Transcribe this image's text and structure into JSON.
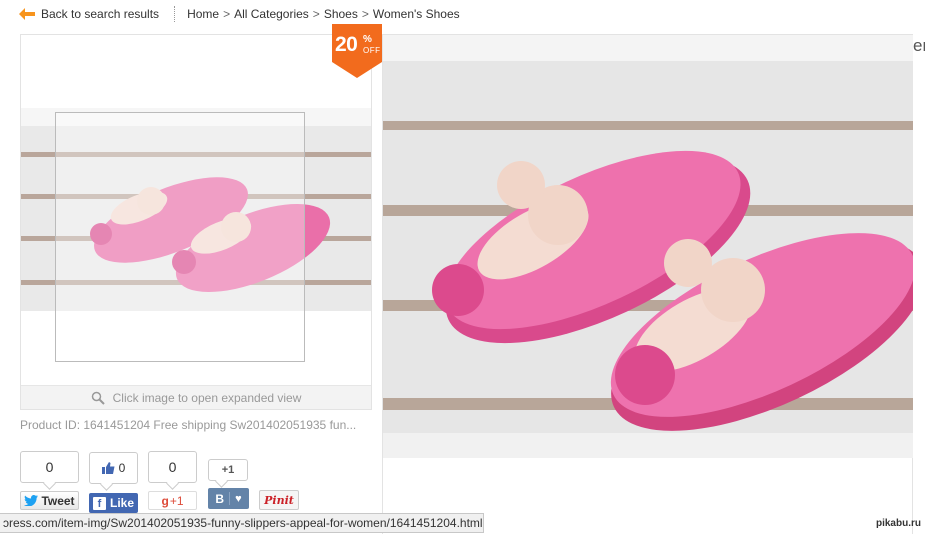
{
  "nav": {
    "back_label": "Back to search results",
    "breadcrumbs": [
      "Home",
      "All Categories",
      "Shoes",
      "Women's Shoes"
    ],
    "separator": ">"
  },
  "gallery": {
    "expand_hint": "Click image to open expanded view",
    "product_id": "Product ID: 1641451204 Free shipping Sw201402051935 fun..."
  },
  "badge": {
    "discount": "20",
    "percent": "%",
    "off": "OFF"
  },
  "social": {
    "twitter_count": "0",
    "twitter_label": "Tweet",
    "facebook_count": "0",
    "facebook_label": "Like",
    "gplus_count": "0",
    "gplus_label": "+1",
    "vk_count": "+1",
    "vk_label": "B",
    "pinterest_label": "Pinit"
  },
  "edge_heading_fragment": "er",
  "status_url": "ɔress.com/item-img/Sw201402051935-funny-slippers-appeal-for-women/1641451204.html",
  "watermark": "pikabu.ru",
  "colors": {
    "discount_orange": "#f26b1d",
    "facebook_blue": "#4267b2",
    "vk_blue": "#6383a8",
    "gplus_red": "#dd4b39",
    "pinterest_red": "#cb2027",
    "back_arrow": "#f7941d"
  }
}
